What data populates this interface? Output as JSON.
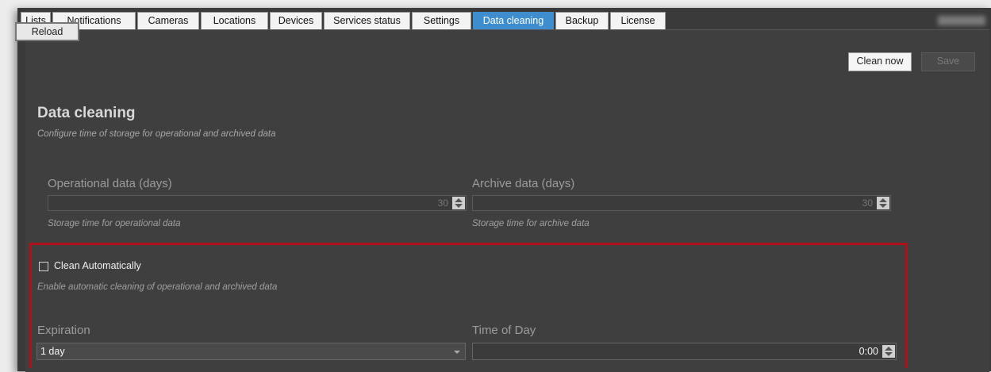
{
  "tabs": [
    {
      "label": "Lists"
    },
    {
      "label": "Notifications"
    },
    {
      "label": "Cameras"
    },
    {
      "label": "Locations"
    },
    {
      "label": "Devices"
    },
    {
      "label": "Services status"
    },
    {
      "label": "Settings"
    },
    {
      "label": "Data cleaning",
      "active": true
    },
    {
      "label": "Backup"
    },
    {
      "label": "License"
    }
  ],
  "toolbar": {
    "reload_label": "Reload",
    "clean_now_label": "Clean now",
    "save_label": "Save"
  },
  "section": {
    "title": "Data cleaning",
    "subtitle": "Configure time of storage for operational and archived data"
  },
  "operational": {
    "label": "Operational data (days)",
    "value": "30",
    "hint": "Storage time for operational data"
  },
  "archive": {
    "label": "Archive data (days)",
    "value": "30",
    "hint": "Storage time for archive data"
  },
  "auto_clean": {
    "label": "Clean Automatically",
    "checked": false,
    "hint": "Enable automatic cleaning of operational and archived data"
  },
  "expiration": {
    "label": "Expiration",
    "selected": "1 day"
  },
  "time_of_day": {
    "label": "Time of Day",
    "value": "0:00"
  },
  "colors": {
    "active_tab": "#3e8ecf",
    "highlight_border": "#b0101a",
    "panel_bg": "#3f3f3f"
  }
}
